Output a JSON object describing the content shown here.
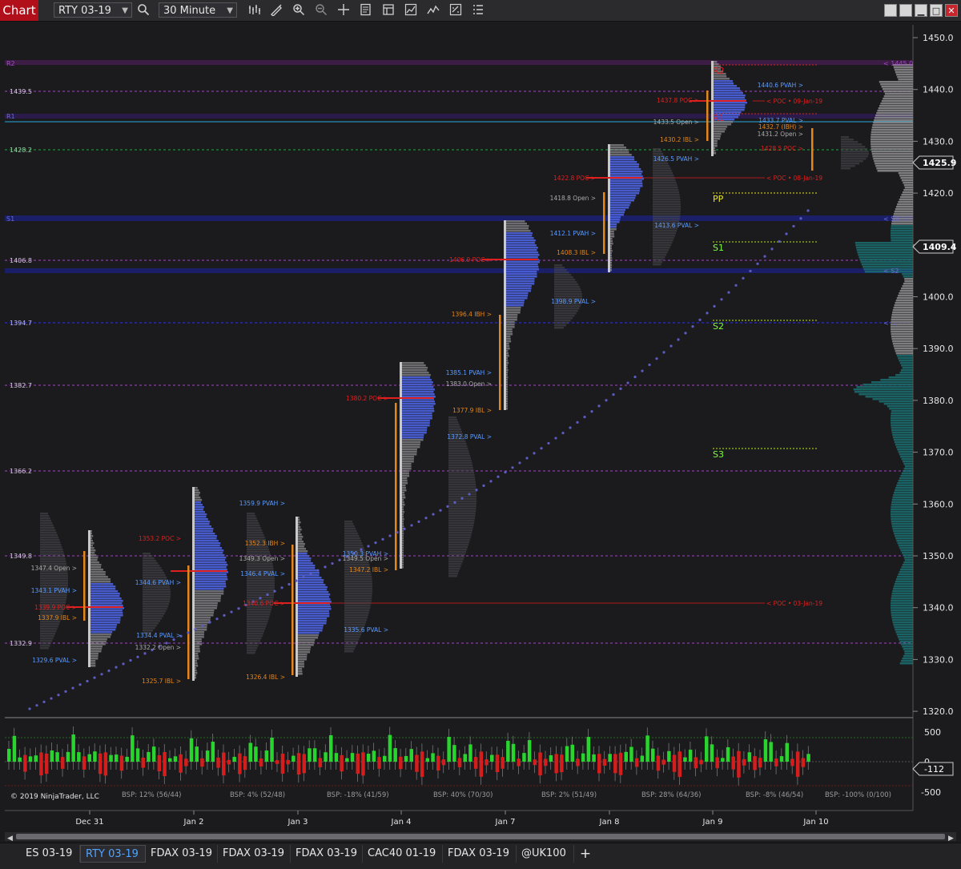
{
  "toolbar": {
    "chart_label": "Chart",
    "instrument": "RTY 03-19",
    "interval": "30 Minute"
  },
  "price_axis": {
    "ticks": [
      "1450.0",
      "1440.0",
      "1430.0",
      "1420.0",
      "1410.0",
      "1400.0",
      "1390.0",
      "1380.0",
      "1370.0",
      "1360.0",
      "1350.0",
      "1340.0",
      "1330.0",
      "1320.0"
    ],
    "last_price": "1425.9",
    "marker_price": "1409.4"
  },
  "indicator_axis": {
    "ticks": [
      "500",
      "0",
      "-500"
    ],
    "current": "-112"
  },
  "time_axis": [
    "Dec 31",
    "Jan 2",
    "Jan 3",
    "Jan 4",
    "Jan 7",
    "Jan 8",
    "Jan 9",
    "Jan 10"
  ],
  "copyright": "© 2019 NinjaTrader, LLC",
  "bsp_labels": [
    "BSP: 12% (56/44)",
    "BSP: 4% (52/48)",
    "BSP: -18% (41/59)",
    "BSP: 40% (70/30)",
    "BSP: 2% (51/49)",
    "BSP: 28% (64/36)",
    "BSP: -8% (46/54)",
    "BSP: -100% (0/100)"
  ],
  "left_levels": [
    "R2",
    "1439.5",
    "R1",
    "1428.2",
    "1406.8",
    "S1",
    "1394.7",
    "1382.7",
    "1366.2",
    "1349.8",
    "1332.9"
  ],
  "pivots": [
    "PP",
    "S1",
    "S2",
    "S3",
    "R2",
    "R1"
  ],
  "right_edge": {
    "r2": "< 1445.0",
    "s1": "< S1",
    "s2": "< S2",
    "ext": "< ..."
  },
  "annotations": [
    "1347.4 Open >",
    "1343.1 PVAH >",
    "1339.9 POC >",
    "1337.9 IBL >",
    "1329.6 PVAL >",
    "1353.2 POC >",
    "1344.6 PVAH >",
    "1334.4 PVAL >",
    "1332.2 Open >",
    "1325.7 IBL >",
    "1359.9 PVAH >",
    "1352.3 IBH >",
    "1349.3 Open >",
    "1346.4 PVAL >",
    "1340.6 POC >",
    "1326.4 IBL >",
    "1350.3 PVAH >",
    "1349.5 Open >",
    "1347.2 IBL >",
    "1335.6 PVAL >",
    "1380.2 POC >",
    "1385.1 PVAH >",
    "1383.0 Open >",
    "1377.9 IBL >",
    "1372.8 PVAL >",
    "1396.4 IBH >",
    "1406.9 POC >",
    "1412.1 PVAH >",
    "1408.3 IBL >",
    "1398.9 PVAL >",
    "1422.8 POC >",
    "1418.8 Open >",
    "1413.6 PVAL >",
    "1437.8 POC >",
    "1440.6 PVAH >",
    "1433.5 Open >",
    "1430.2 IBL >",
    "1426.5 PVAH >",
    "1433.7 PVAL >",
    "1432.7 (IBH) >",
    "1431.2 Open >",
    "1428.5 POC >",
    "< POC • 09-Jan-19",
    "< POC • 08-Jan-19",
    "< POC • 03-Jan-19"
  ],
  "instrument_tabs": [
    "ES 03-19",
    "RTY 03-19",
    "FDAX 03-19",
    "FDAX 03-19",
    "FDAX 03-19",
    "CAC40 01-19",
    "FDAX 03-19",
    "@UK100"
  ],
  "active_tab": 1,
  "add_tab": "+",
  "colors": {
    "background": "#1b1b1d",
    "poc": "#e0201e",
    "pvah": "#5b9bff",
    "ibl": "#e3861b",
    "volume_profile": "#4a5fd6",
    "pivot": "#e8e81c",
    "s_label": "#7cff3a",
    "pivot_purple": "#b23fd8",
    "up_bar": "#28d42d",
    "down_bar": "#d41e1e",
    "tab_active": "#4fa3ff",
    "close": "#c8252c"
  },
  "icons": [
    "search-icon",
    "bar-type-icon",
    "draw-icon",
    "zoom-in-icon",
    "zoom-out-icon",
    "crosshair-icon",
    "data-box-icon",
    "template-icon",
    "strategy-icon",
    "indicator-icon",
    "properties-icon",
    "list-icon"
  ]
}
